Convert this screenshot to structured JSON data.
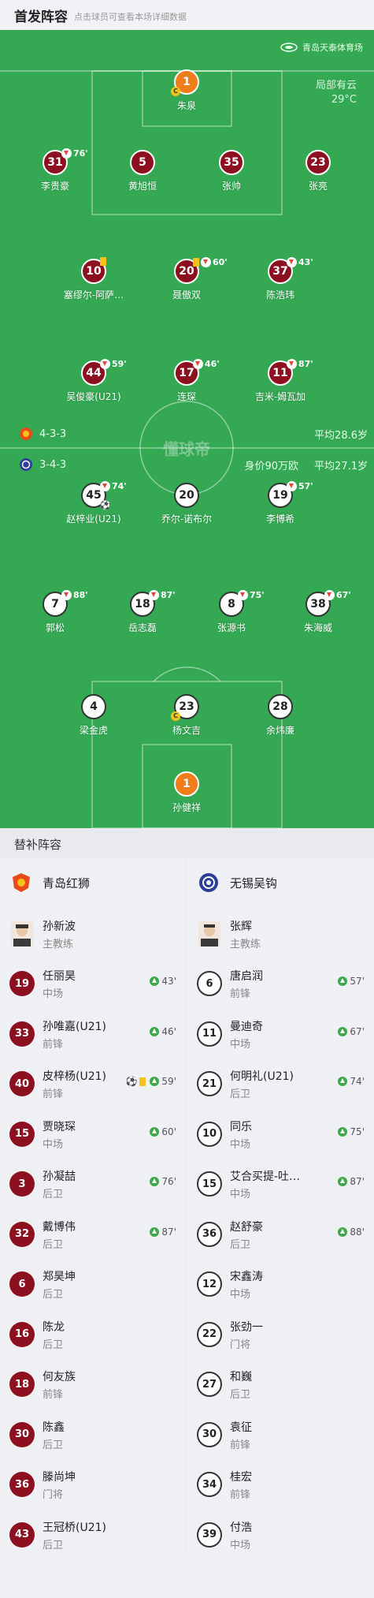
{
  "header": {
    "title": "首发阵容",
    "subtitle": "点击球员可查看本场详细数据"
  },
  "pitch": {
    "venue": "青岛天泰体育场",
    "weather": "局部有云",
    "temperature": "29°C",
    "watermark": "懂球帝",
    "home_formation": "4-3-3",
    "home_avg_age": "平均28.6岁",
    "away_formation": "3-4-3",
    "away_value": "身价90万欧",
    "away_avg_age": "平均27.1岁"
  },
  "home_lineup": [
    {
      "num": "1",
      "name": "朱泉",
      "gk": true,
      "captain": true
    },
    {
      "num": "31",
      "name": "李贵豪",
      "sub": "76'"
    },
    {
      "num": "5",
      "name": "黄旭恒"
    },
    {
      "num": "35",
      "name": "张帅"
    },
    {
      "num": "23",
      "name": "张亮"
    },
    {
      "num": "10",
      "name": "塞缪尔-阿萨…",
      "yellow": true
    },
    {
      "num": "20",
      "name": "聂傲双",
      "yellow": true,
      "sub": "60'"
    },
    {
      "num": "37",
      "name": "陈浩玮",
      "sub": "43'"
    },
    {
      "num": "44",
      "name": "吴俊豪(U21)",
      "sub": "59'"
    },
    {
      "num": "17",
      "name": "连琛",
      "sub": "46'"
    },
    {
      "num": "11",
      "name": "吉米-姆瓦加",
      "sub": "87'"
    }
  ],
  "away_lineup": [
    {
      "num": "45",
      "name": "赵梓业(U21)",
      "sub": "74'",
      "goal": true
    },
    {
      "num": "20",
      "name": "乔尔-诺布尔"
    },
    {
      "num": "19",
      "name": "李博希",
      "sub": "57'"
    },
    {
      "num": "7",
      "name": "郭松",
      "sub": "88'"
    },
    {
      "num": "18",
      "name": "岳志磊",
      "sub": "87'"
    },
    {
      "num": "8",
      "name": "张源书",
      "sub": "75'"
    },
    {
      "num": "38",
      "name": "朱海威",
      "sub": "67'"
    },
    {
      "num": "4",
      "name": "梁金虎"
    },
    {
      "num": "23",
      "name": "杨文吉",
      "captain": true
    },
    {
      "num": "28",
      "name": "余炜廉"
    },
    {
      "num": "1",
      "name": "孙健祥",
      "gk": true
    }
  ],
  "subs": {
    "title": "替补阵容",
    "home": {
      "team": "青岛红狮",
      "coach_name": "孙新波",
      "coach_role": "主教练",
      "players": [
        {
          "num": "19",
          "name": "任丽昊",
          "pos": "中场",
          "in": "43'"
        },
        {
          "num": "33",
          "name": "孙唯嘉(U21)",
          "pos": "前锋",
          "in": "46'"
        },
        {
          "num": "40",
          "name": "皮梓杨(U21)",
          "pos": "前锋",
          "in": "59'",
          "goal": true,
          "yellow": true
        },
        {
          "num": "15",
          "name": "贾晓琛",
          "pos": "中场",
          "in": "60'"
        },
        {
          "num": "3",
          "name": "孙凝喆",
          "pos": "后卫",
          "in": "76'"
        },
        {
          "num": "32",
          "name": "戴博伟",
          "pos": "后卫",
          "in": "87'"
        },
        {
          "num": "6",
          "name": "郑昊坤",
          "pos": "后卫"
        },
        {
          "num": "16",
          "name": "陈龙",
          "pos": "后卫"
        },
        {
          "num": "18",
          "name": "何友族",
          "pos": "前锋"
        },
        {
          "num": "30",
          "name": "陈鑫",
          "pos": "后卫"
        },
        {
          "num": "36",
          "name": "滕尚坤",
          "pos": "门将"
        },
        {
          "num": "43",
          "name": "王冠桥(U21)",
          "pos": "后卫"
        }
      ]
    },
    "away": {
      "team": "无锡吴钩",
      "coach_name": "张辉",
      "coach_role": "主教练",
      "players": [
        {
          "num": "6",
          "name": "唐启润",
          "pos": "前锋",
          "in": "57'"
        },
        {
          "num": "11",
          "name": "曼迪奇",
          "pos": "中场",
          "in": "67'"
        },
        {
          "num": "21",
          "name": "何明礼(U21)",
          "pos": "后卫",
          "in": "74'"
        },
        {
          "num": "10",
          "name": "同乐",
          "pos": "中场",
          "in": "75'"
        },
        {
          "num": "15",
          "name": "艾合买提-吐…",
          "pos": "中场",
          "in": "87'"
        },
        {
          "num": "36",
          "name": "赵舒豪",
          "pos": "后卫",
          "in": "88'"
        },
        {
          "num": "12",
          "name": "宋鑫涛",
          "pos": "中场"
        },
        {
          "num": "22",
          "name": "张劲一",
          "pos": "门将"
        },
        {
          "num": "27",
          "name": "和巍",
          "pos": "后卫"
        },
        {
          "num": "30",
          "name": "袁征",
          "pos": "前锋"
        },
        {
          "num": "34",
          "name": "桂宏",
          "pos": "前锋"
        },
        {
          "num": "39",
          "name": "付浩",
          "pos": "中场"
        }
      ]
    }
  },
  "colors": {
    "pitch": "#34a853",
    "home": "#8c1020",
    "goalkeeper": "#f07c1a",
    "sub_in": "#3fa84a"
  }
}
